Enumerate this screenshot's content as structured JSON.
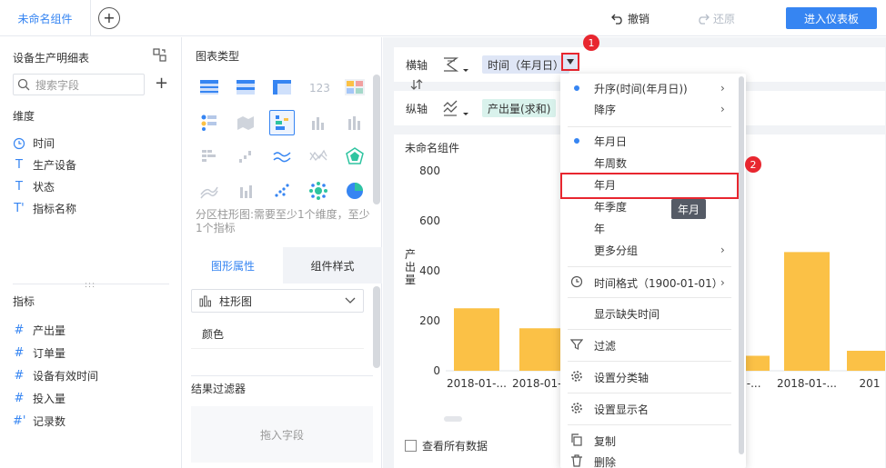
{
  "topbar": {
    "tab_label": "未命名组件",
    "undo_label": "撤销",
    "redo_label": "还原",
    "enter_label": "进入仪表板"
  },
  "left_panel": {
    "table_name": "设备生产明细表",
    "search_placeholder": "搜索字段",
    "dimension_title": "维度",
    "dimensions": [
      {
        "icon": "clock-icon",
        "label": "时间"
      },
      {
        "icon": "text-icon",
        "label": "生产设备"
      },
      {
        "icon": "text-icon",
        "label": "状态"
      },
      {
        "icon": "text-formula-icon",
        "label": "指标名称"
      }
    ],
    "measure_title": "指标",
    "measures": [
      {
        "icon": "hash-icon",
        "label": "产出量"
      },
      {
        "icon": "hash-icon",
        "label": "订单量"
      },
      {
        "icon": "hash-icon",
        "label": "设备有效时间"
      },
      {
        "icon": "hash-icon",
        "label": "投入量"
      },
      {
        "icon": "hash-formula-icon",
        "label": "记录数"
      }
    ]
  },
  "middle_panel": {
    "chart_type_title": "图表类型",
    "chart_type_hint": "分区柱形图:需要至少1个维度，至少1个指标",
    "tabs": [
      "图形属性",
      "组件样式"
    ],
    "chart_type_selected": "柱形图",
    "color_label": "颜色",
    "result_filter_title": "结果过滤器",
    "drop_field_placeholder": "拖入字段"
  },
  "axes": {
    "x_label": "横轴",
    "x_field": "时间（年月日）",
    "y_label": "纵轴",
    "y_field": "产出量(求和)"
  },
  "chart_card": {
    "title": "未命名组件",
    "show_all_label": "查看所有数据",
    "ylabel": "产出量"
  },
  "chart_data": {
    "type": "bar",
    "ylabel": "产出量",
    "ylim": [
      0,
      800
    ],
    "yticks": [
      "800",
      "600",
      "400",
      "200",
      "0"
    ],
    "categories": [
      "2018-01-...",
      "2018-01-...",
      "01-...",
      "2018-01-...",
      "201"
    ],
    "values": [
      250,
      170,
      60,
      475,
      80
    ],
    "color": "#fbc146"
  },
  "menu": {
    "items": [
      {
        "label": "升序(时间(年月日))",
        "selected": true,
        "submenu": true
      },
      {
        "label": "降序",
        "selected": false,
        "submenu": true
      },
      {
        "label": "年月日",
        "selected": true,
        "submenu": false
      },
      {
        "label": "年周数",
        "selected": false,
        "submenu": false
      },
      {
        "label": "年月",
        "selected": false,
        "submenu": false
      },
      {
        "label": "年季度",
        "selected": false,
        "submenu": false
      },
      {
        "label": "年",
        "selected": false,
        "submenu": false
      },
      {
        "label": "更多分组",
        "selected": false,
        "submenu": true
      },
      {
        "label": "时间格式（1900-01-01）",
        "icon": "clock-icon",
        "submenu": true
      },
      {
        "label": "显示缺失时间",
        "submenu": false
      },
      {
        "label": "过滤",
        "icon": "filter-icon",
        "submenu": false
      },
      {
        "label": "设置分类轴",
        "icon": "gear-icon",
        "submenu": false
      },
      {
        "label": "设置显示名",
        "icon": "gear-icon",
        "submenu": false
      },
      {
        "label": "复制",
        "icon": "copy-icon",
        "submenu": false
      },
      {
        "label": "删除",
        "icon": "trash-icon",
        "submenu": false
      }
    ],
    "tooltip": "年月"
  },
  "badges": [
    "1",
    "2"
  ],
  "colors": {
    "accent": "#3685f2",
    "bar": "#fbc146",
    "highlight": "#e8262f"
  }
}
